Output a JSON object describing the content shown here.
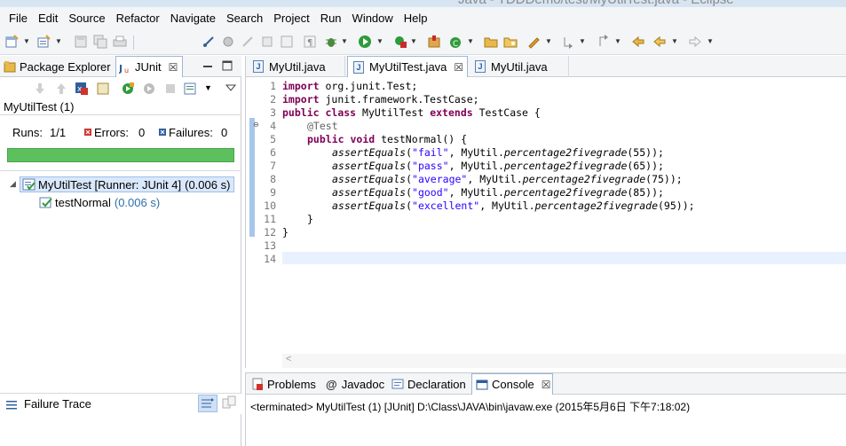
{
  "window": {
    "title": "Java - TDDDemo/test/MyUtilTest.java - Eclipse"
  },
  "menu": [
    "File",
    "Edit",
    "Source",
    "Refactor",
    "Navigate",
    "Search",
    "Project",
    "Run",
    "Window",
    "Help"
  ],
  "left_views": {
    "tabs": [
      {
        "label": "Package Explorer",
        "icon": "package-explorer-icon"
      },
      {
        "label": "JUnit",
        "icon": "junit-icon",
        "close": "☒"
      }
    ],
    "junit": {
      "run_name": "MyUtilTest (1)",
      "runs_label": "Runs:",
      "runs_value": "1/1",
      "errors_label": "Errors:",
      "errors_value": "0",
      "failures_label": "Failures:",
      "failures_value": "0",
      "progress": 1.0,
      "progress_color": "#5cc15d",
      "tree": [
        {
          "label": "MyUtilTest [Runner: JUnit 4]",
          "time": "(0.006 s)",
          "level": 0,
          "expanded": true
        },
        {
          "label": "testNormal",
          "time": "(0.006 s)",
          "level": 1
        }
      ],
      "failure_trace_label": "Failure Trace"
    }
  },
  "editor": {
    "tabs": [
      {
        "label": "MyUtil.java",
        "active": false
      },
      {
        "label": "MyUtilTest.java",
        "active": true,
        "close": "☒"
      },
      {
        "label": "MyUtil.java",
        "active": false
      }
    ],
    "line_numbers": [
      "1",
      "2",
      "3",
      "4",
      "5",
      "6",
      "7",
      "8",
      "9",
      "10",
      "11",
      "12",
      "13",
      "14"
    ],
    "code": {
      "l1_kw": "import",
      "l1_rest": " org.junit.Test;",
      "l2_kw": "import",
      "l2_rest": " junit.framework.TestCase;",
      "l3_kw1": "public",
      "l3_kw2": "class",
      "l3_name": " MyUtilTest ",
      "l3_kw3": "extends",
      "l3_rest": " TestCase {",
      "l4_ann": "@Test",
      "l5_kw1": "public",
      "l5_kw2": "void",
      "l5_rest": " testNormal() {",
      "assert_method": "assertEquals",
      "call_prefix": ", MyUtil.",
      "call_method": "percentage2fivegrade",
      "asserts": [
        {
          "expected": "\"fail\"",
          "arg": "(55));"
        },
        {
          "expected": "\"pass\"",
          "arg": "(65));"
        },
        {
          "expected": "\"average\"",
          "arg": "(75));"
        },
        {
          "expected": "\"good\"",
          "arg": "(85));"
        },
        {
          "expected": "\"excellent\"",
          "arg": "(95));"
        }
      ],
      "l11": "}",
      "l12": "}"
    },
    "scroll_left_glyph": "<"
  },
  "bottom": {
    "tabs": [
      {
        "label": "Problems",
        "icon": "problems-icon"
      },
      {
        "label": "Javadoc",
        "icon": "at-sign-icon",
        "glyph": "@"
      },
      {
        "label": "Declaration",
        "icon": "declaration-icon"
      },
      {
        "label": "Console",
        "icon": "console-icon",
        "active": true,
        "close": "☒"
      }
    ],
    "console_text": "<terminated> MyUtilTest (1) [JUnit] D:\\Class\\JAVA\\bin\\javaw.exe (2015年5月6日 下午7:18:02)"
  },
  "colors": {
    "keyword": "#7f0055",
    "string": "#2a00ff",
    "annotation": "#646464",
    "progress_green": "#5cc15d",
    "error_red": "#d0332b",
    "failure_blue": "#2e5f9e"
  }
}
